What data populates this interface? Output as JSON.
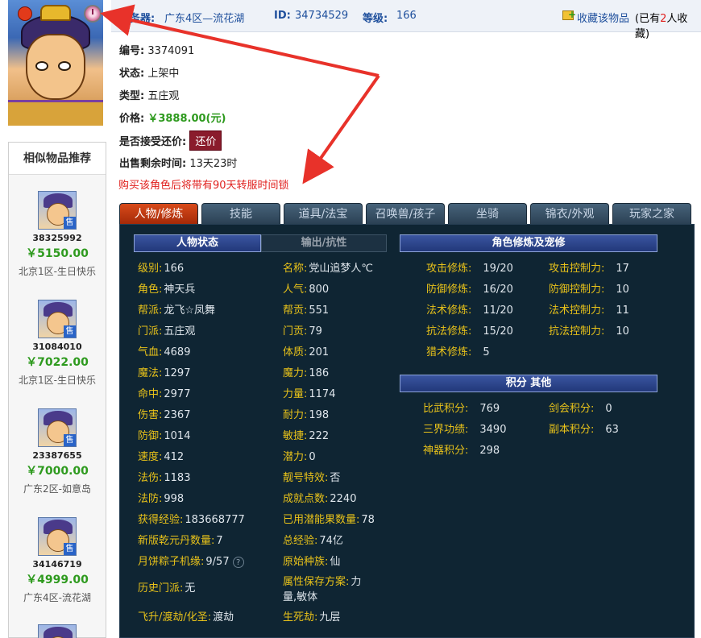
{
  "header": {
    "server_label": "服务器:",
    "server_value": "广东4区—流花湖",
    "id_label": "ID:",
    "id_value": "34734529",
    "level_label": "等级:",
    "level_value": "166",
    "fav_link": "收藏该物品",
    "fav_prefix": "(已有",
    "fav_num": "2",
    "fav_suffix": "人收藏)"
  },
  "info": {
    "number_label": "编号:",
    "number_value": "3374091",
    "status_label": "状态:",
    "status_value": "上架中",
    "type_label": "类型:",
    "type_value": "五庄观",
    "price_label": "价格:",
    "price_value": "￥3888.00(元)",
    "bargain_label": "是否接受还价:",
    "bargain_button": "还价",
    "remaining_label": "出售剩余时间:",
    "remaining_value": "13天23时",
    "transfer_notice": "购买该角色后将带有90天转服时间锁"
  },
  "sidebar": {
    "title": "相似物品推荐",
    "sell_badge": "售",
    "items": [
      {
        "id": "38325992",
        "price": "￥5150.00",
        "server": "北京1区-生日快乐"
      },
      {
        "id": "31084010",
        "price": "￥7022.00",
        "server": "北京1区-生日快乐"
      },
      {
        "id": "23387655",
        "price": "￥7000.00",
        "server": "广东2区-如意岛"
      },
      {
        "id": "34146719",
        "price": "￥4999.00",
        "server": "广东4区-流花湖"
      }
    ]
  },
  "tabs": [
    "人物/修炼",
    "技能",
    "道具/法宝",
    "召唤兽/孩子",
    "坐骑",
    "锦衣/外观",
    "玩家之家"
  ],
  "panel": {
    "status_tab": "人物状态",
    "output_tab": "输出/抗性",
    "cultivation_title": "角色修炼及宠修",
    "points_title": "积分 其他",
    "left_col": [
      {
        "label": "级别:",
        "value": "166"
      },
      {
        "label": "角色:",
        "value": "神天兵"
      },
      {
        "label": "帮派:",
        "value": "龙飞☆凤舞"
      },
      {
        "label": "门派:",
        "value": "五庄观"
      },
      {
        "label": "气血:",
        "value": "4689"
      },
      {
        "label": "魔法:",
        "value": "1297"
      },
      {
        "label": "命中:",
        "value": "2977"
      },
      {
        "label": "伤害:",
        "value": "2367"
      },
      {
        "label": "防御:",
        "value": "1014"
      },
      {
        "label": "速度:",
        "value": "412"
      },
      {
        "label": "法伤:",
        "value": "1183"
      },
      {
        "label": "法防:",
        "value": "998"
      },
      {
        "label": "获得经验:",
        "value": "183668777"
      },
      {
        "label": "新版乾元丹数量:",
        "value": "7"
      },
      {
        "label": "月饼粽子机缘:",
        "value": "9/57"
      },
      {
        "label": "历史门派:",
        "value": "无"
      },
      {
        "label": "飞升/渡劫/化圣:",
        "value": "渡劫"
      }
    ],
    "mid_col": [
      {
        "label": "名称:",
        "value": "党山追梦人℃"
      },
      {
        "label": "人气:",
        "value": "800"
      },
      {
        "label": "帮贡:",
        "value": "551"
      },
      {
        "label": "门贡:",
        "value": "79"
      },
      {
        "label": "体质:",
        "value": "201"
      },
      {
        "label": "魔力:",
        "value": "186"
      },
      {
        "label": "力量:",
        "value": "1174"
      },
      {
        "label": "耐力:",
        "value": "198"
      },
      {
        "label": "敏捷:",
        "value": "222"
      },
      {
        "label": "潜力:",
        "value": "0"
      },
      {
        "label": "靓号特效:",
        "value": "否"
      },
      {
        "label": "成就点数:",
        "value": "2240"
      },
      {
        "label": "已用潜能果数量:",
        "value": "78"
      },
      {
        "label": "总经验:",
        "value": "74亿"
      },
      {
        "label": "原始种族:",
        "value": "仙"
      },
      {
        "label": "属性保存方案:",
        "value": "力",
        "value2": "量,敏体"
      },
      {
        "label": "生死劫:",
        "value": "九层"
      }
    ],
    "cultivation": [
      {
        "label": "攻击修炼:",
        "value": "19/20",
        "label2": "攻击控制力:",
        "value2": "17"
      },
      {
        "label": "防御修炼:",
        "value": "16/20",
        "label2": "防御控制力:",
        "value2": "10"
      },
      {
        "label": "法术修炼:",
        "value": "11/20",
        "label2": "法术控制力:",
        "value2": "11"
      },
      {
        "label": "抗法修炼:",
        "value": "15/20",
        "label2": "抗法控制力:",
        "value2": "10"
      },
      {
        "label": "猎术修炼:",
        "value": "5"
      }
    ],
    "points": [
      {
        "label": "比武积分:",
        "value": "769",
        "label2": "剑会积分:",
        "value2": "0"
      },
      {
        "label": "三界功绩:",
        "value": "3490",
        "label2": "副本积分:",
        "value2": "63"
      },
      {
        "label": "神器积分:",
        "value": "298"
      }
    ]
  },
  "colors": {
    "accent_red": "#e0201e",
    "price_green": "#2e9a1e",
    "panel_bg": "#0f2533",
    "label_yellow": "#e8c21a"
  }
}
